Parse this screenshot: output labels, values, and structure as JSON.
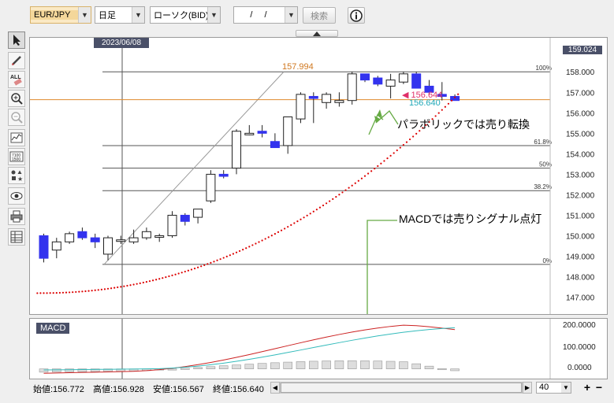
{
  "toolbar": {
    "pair": "EUR/JPY",
    "period": "日足",
    "chart_type": "ローソク(BID)",
    "date_input": "/ /",
    "search_label": "検索",
    "info_icon": "info-icon"
  },
  "chart": {
    "crosshair_date": "2023/06/08",
    "y_axis_labels": [
      "158.000",
      "157.000",
      "156.000",
      "155.000",
      "154.000",
      "153.000",
      "152.000",
      "151.000",
      "150.000",
      "149.000",
      "148.000",
      "147.000"
    ],
    "y_axis_top_partial": "159.024",
    "fib_labels": [
      "100%",
      "61.8%",
      "50%",
      "38.2%",
      "0%"
    ],
    "high_label": "157.994",
    "price_red": "156.644",
    "price_cyan": "156.640",
    "annotation_sar": "パラボリックでは売り転換",
    "annotation_macd": "MACDでは売りシグナル点灯"
  },
  "macd": {
    "label": "MACD",
    "y_axis_labels": [
      "200.0000",
      "100.0000",
      "0.0000"
    ]
  },
  "status": {
    "open": "始値:156.772",
    "high": "高値:156.928",
    "low": "安値:156.567",
    "close": "終値:156.640",
    "count": "40"
  },
  "colors": {
    "bear_candle": "#3333ee",
    "bull_candle": "#ffffff",
    "sar": "#dd0000",
    "fib_line": "#555555",
    "price_line": "#e08a2c",
    "macd_line": "#cc2222",
    "signal_line": "#33bbbb",
    "arrow": "#66aa44"
  },
  "chart_data": {
    "type": "candlestick",
    "candles_ohlc": [
      [
        150.0,
        150.1,
        148.7,
        148.9
      ],
      [
        149.3,
        149.9,
        148.9,
        149.7
      ],
      [
        149.7,
        150.2,
        149.6,
        150.1
      ],
      [
        150.2,
        150.4,
        149.8,
        149.9
      ],
      [
        149.9,
        150.1,
        149.4,
        149.7
      ],
      [
        149.1,
        150.0,
        148.8,
        149.9
      ],
      [
        149.8,
        150.0,
        149.6,
        149.8
      ],
      [
        149.7,
        150.3,
        149.6,
        149.9
      ],
      [
        149.9,
        150.4,
        149.8,
        150.2
      ],
      [
        150.0,
        150.1,
        149.7,
        150.0
      ],
      [
        150.0,
        151.2,
        149.9,
        151.0
      ],
      [
        151.0,
        151.1,
        150.5,
        150.7
      ],
      [
        150.9,
        151.2,
        150.6,
        151.3
      ],
      [
        151.7,
        153.2,
        151.6,
        153.0
      ],
      [
        153.0,
        153.2,
        152.8,
        152.9
      ],
      [
        153.3,
        155.2,
        153.0,
        155.1
      ],
      [
        155.0,
        155.4,
        154.9,
        155.0
      ],
      [
        155.1,
        155.4,
        154.8,
        155.0
      ],
      [
        154.6,
        155.0,
        154.3,
        154.3
      ],
      [
        154.4,
        155.8,
        154.0,
        155.8
      ],
      [
        155.7,
        157.0,
        155.5,
        156.9
      ],
      [
        156.8,
        157.0,
        155.5,
        156.7
      ],
      [
        156.5,
        157.0,
        156.2,
        156.9
      ],
      [
        156.5,
        157.0,
        156.3,
        156.6
      ],
      [
        156.6,
        158.0,
        156.4,
        157.9
      ],
      [
        157.9,
        157.9,
        157.5,
        157.6
      ],
      [
        157.7,
        157.8,
        157.3,
        157.4
      ],
      [
        157.3,
        157.9,
        156.7,
        157.6
      ],
      [
        157.5,
        158.0,
        157.4,
        157.9
      ],
      [
        157.9,
        158.0,
        157.2,
        157.2
      ],
      [
        157.3,
        157.6,
        156.9,
        157.0
      ],
      [
        156.9,
        157.5,
        156.6,
        156.8
      ],
      [
        156.8,
        156.9,
        156.6,
        156.6
      ]
    ],
    "parabolic_sar_visible": true,
    "fibonacci_levels": [
      {
        "label": "100%",
        "value": 158.0
      },
      {
        "label": "61.8%",
        "value": 154.4
      },
      {
        "label": "50%",
        "value": 153.3
      },
      {
        "label": "38.2%",
        "value": 152.2
      },
      {
        "label": "0%",
        "value": 148.6
      }
    ],
    "y_range": [
      146.6,
      159.2
    ],
    "macd_series": [
      "MACD",
      "Signal"
    ],
    "macd_y_range": [
      -30,
      215
    ]
  }
}
